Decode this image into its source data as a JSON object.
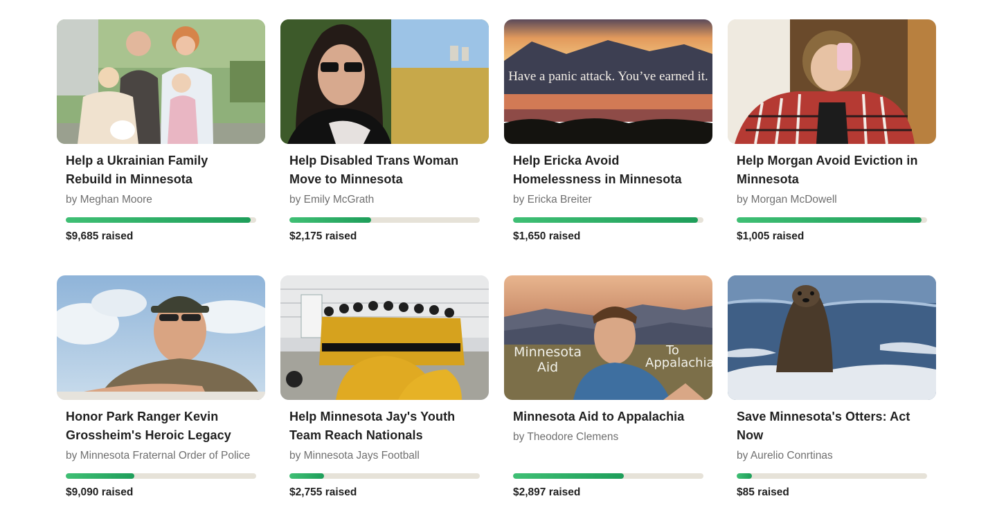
{
  "fundraisers": [
    {
      "title": "Help a Ukrainian Family Rebuild in Minnesota",
      "organizer": "by Meghan Moore",
      "raised": "$9,685 raised",
      "progress": 0.97,
      "image_icon": "family-photo"
    },
    {
      "title": "Help Disabled Trans Woman Move to Minnesota",
      "organizer": "by Emily McGrath",
      "raised": "$2,175 raised",
      "progress": 0.43,
      "image_icon": "portrait-photo"
    },
    {
      "title": "Help Ericka Avoid Homelessness in Minnesota",
      "organizer": "by Ericka Breiter",
      "raised": "$1,650 raised",
      "progress": 0.97,
      "image_icon": "sunset-lake-photo",
      "image_caption": "Have a panic attack. You’ve earned it."
    },
    {
      "title": "Help Morgan Avoid Eviction in Minnesota",
      "organizer": "by Morgan McDowell",
      "raised": "$1,005 raised",
      "progress": 0.97,
      "image_icon": "selfie-photo"
    },
    {
      "title": "Honor Park Ranger Kevin Grossheim's Heroic Legacy",
      "organizer": "by Minnesota Fraternal Order of Police",
      "raised": "$9,090 raised",
      "progress": 0.36,
      "image_icon": "park-ranger-photo"
    },
    {
      "title": "Help Minnesota Jay's Youth Team Reach Nationals",
      "organizer": "by Minnesota Jays Football",
      "raised": "$2,755 raised",
      "progress": 0.18,
      "image_icon": "football-team-photo"
    },
    {
      "title": "Minnesota Aid to Appalachia",
      "organizer": "by Theodore Clemens",
      "raised": "$2,897 raised",
      "progress": 0.58,
      "image_icon": "mountain-selfie-photo",
      "image_caption_left": "Minnesota Aid",
      "image_caption_right_1": "To",
      "image_caption_right_2": "Appalachia"
    },
    {
      "title": "Save Minnesota's Otters: Act Now",
      "organizer": "by Aurelio Conrtinas",
      "raised": "$85 raised",
      "progress": 0.08,
      "image_icon": "otter-photo"
    }
  ],
  "colors": {
    "progress_fill": "#2fb06a",
    "progress_track": "#e6e2d8",
    "title_text": "#1f1f1f",
    "organizer_text": "#6f6f6f"
  }
}
